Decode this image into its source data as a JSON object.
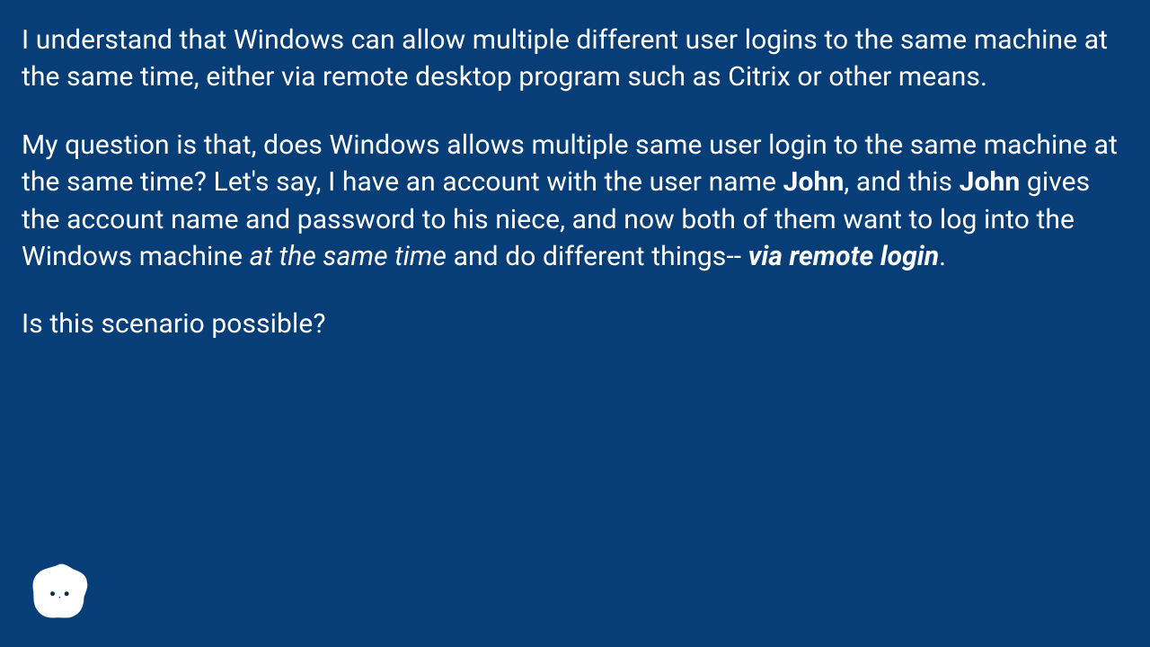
{
  "p1": {
    "t1": "I understand that Windows can allow multiple different user logins to the same machine at the same time, either via remote desktop program such as Citrix or other means."
  },
  "p2": {
    "t1": "My question is that, does Windows allows multiple same user login to the same machine at the same time? Let's say, I have an account with the user name ",
    "b1": "John",
    "t2": ", and this ",
    "b2": "John",
    "t3": " gives the account name and password to his niece, and now both of them want to log into the Windows machine ",
    "i1": "at the same time",
    "t4": " and do different things-- ",
    "bi1": "via remote login",
    "t5": "."
  },
  "p3": {
    "t1": "Is this scenario possible?"
  }
}
